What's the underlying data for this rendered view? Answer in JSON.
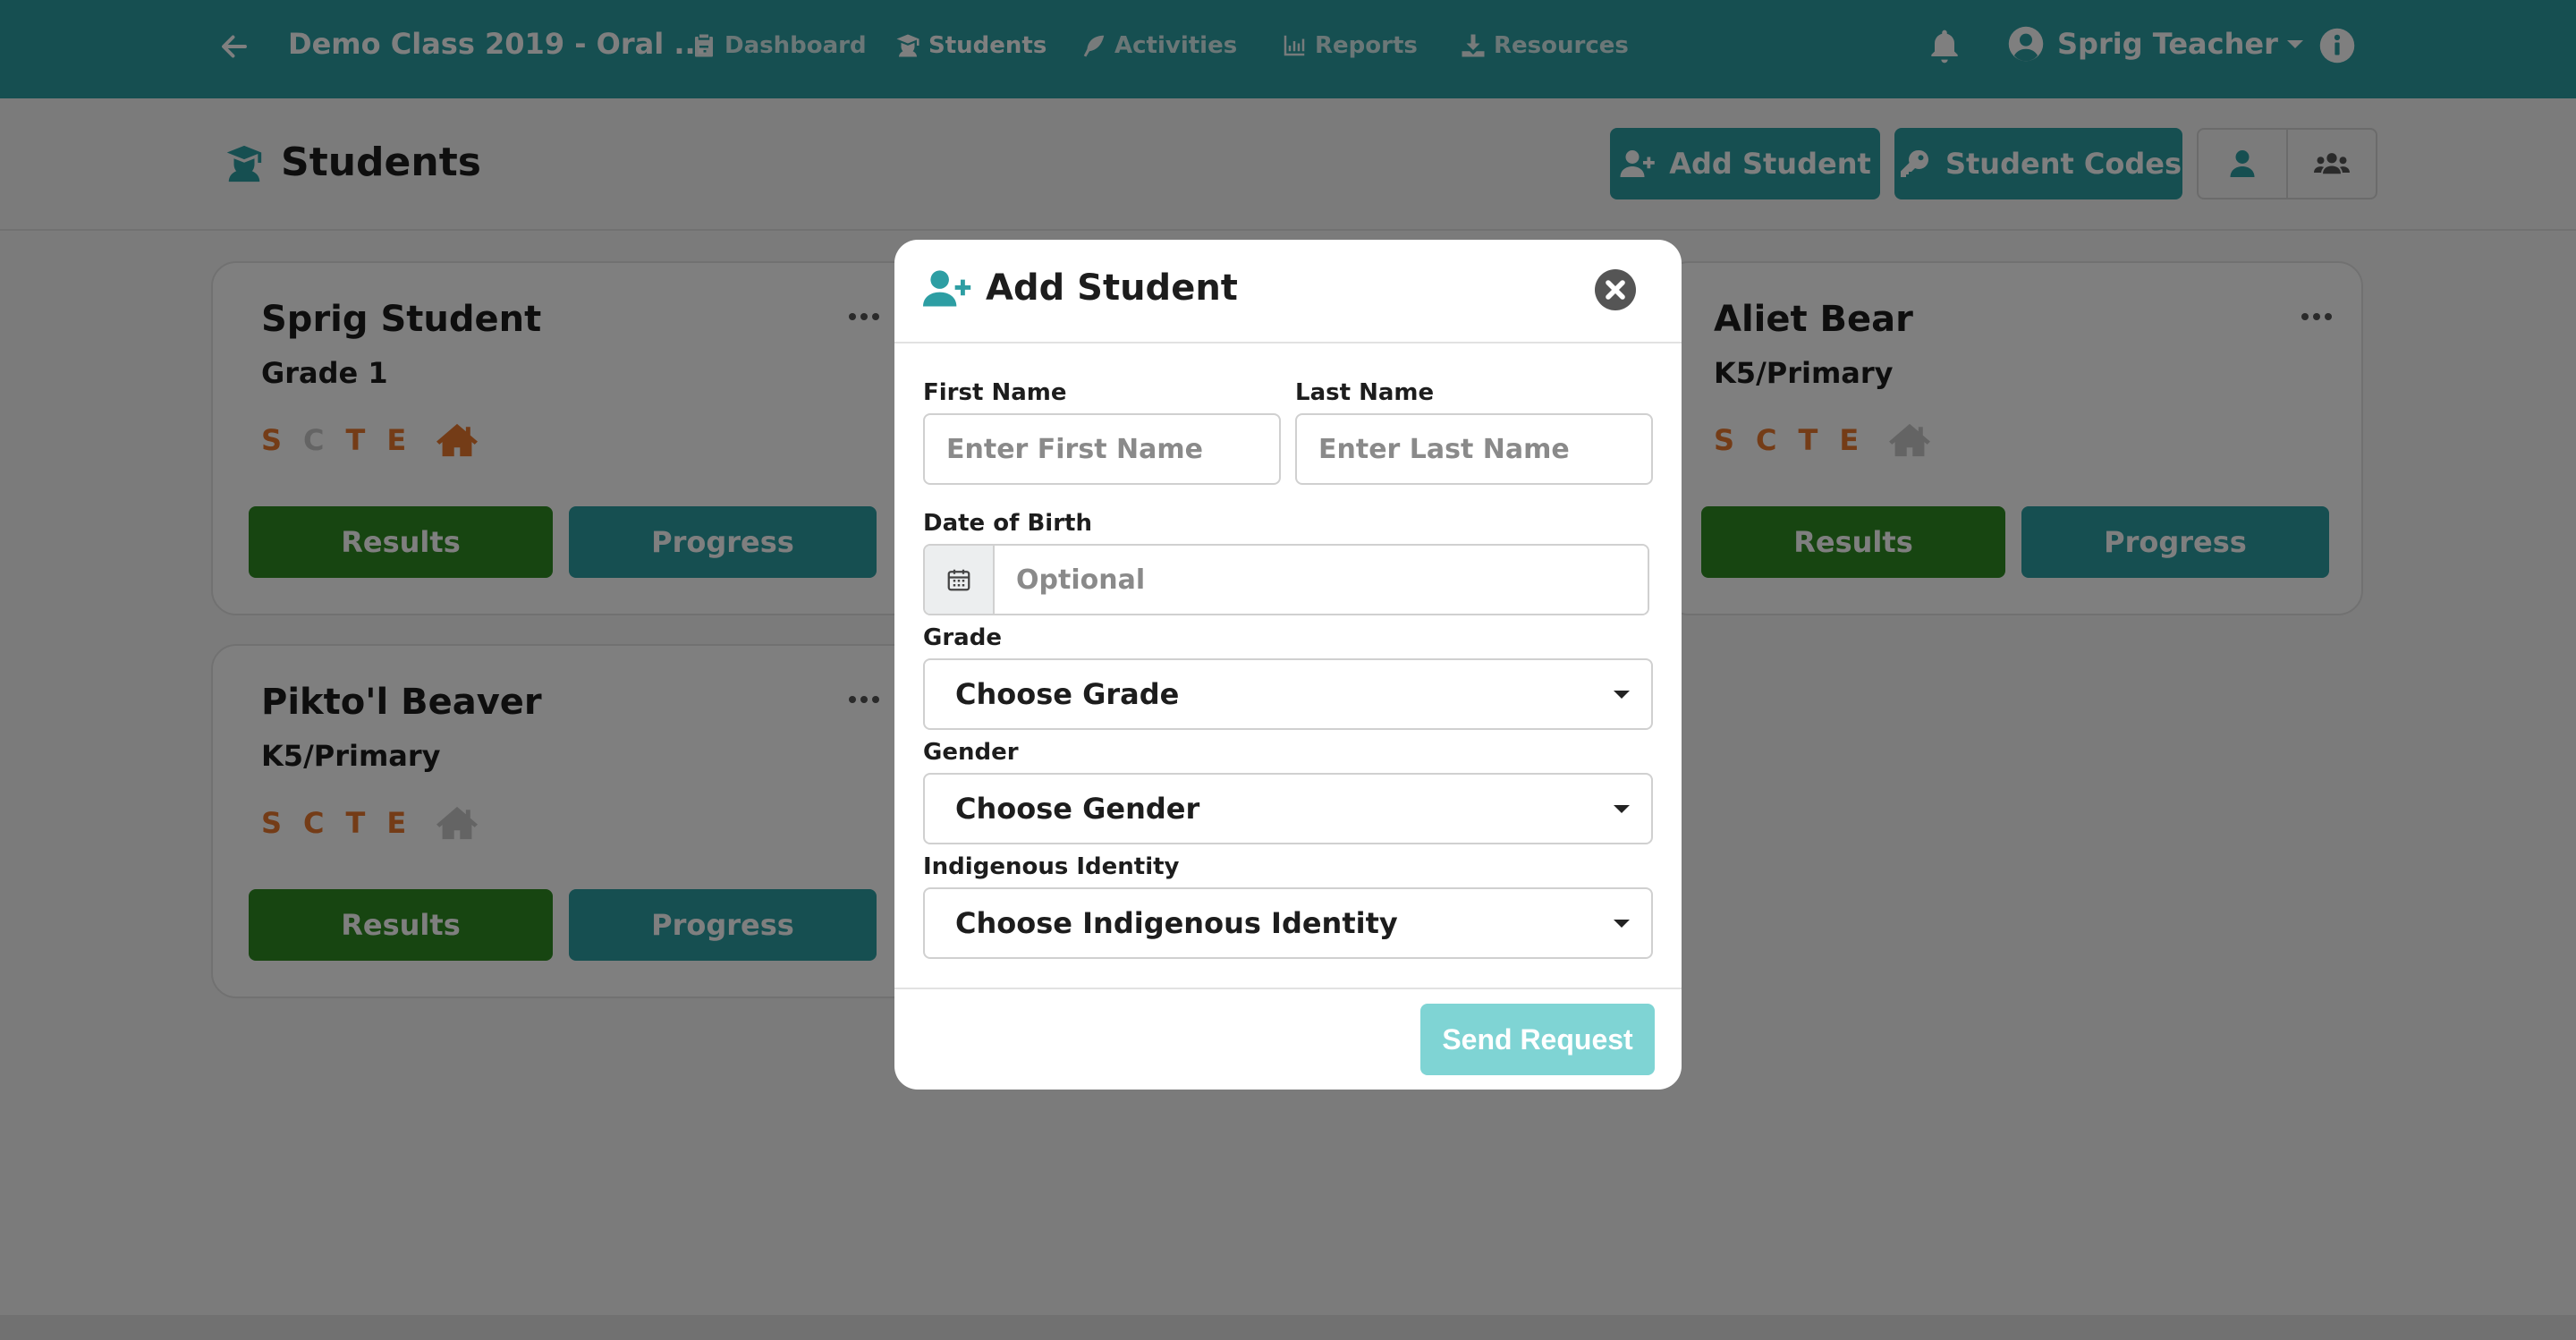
{
  "topbar": {
    "class_title": "Demo Class 2019 - Oral ...",
    "nav": [
      {
        "label": "Dashboard",
        "icon": "clipboard-icon"
      },
      {
        "label": "Students",
        "icon": "graduate-icon"
      },
      {
        "label": "Activities",
        "icon": "feather-icon"
      },
      {
        "label": "Reports",
        "icon": "bar-chart-icon"
      },
      {
        "label": "Resources",
        "icon": "download-icon"
      }
    ],
    "user_name": "Sprig Teacher"
  },
  "header": {
    "title": "Students",
    "add_student_label": "Add Student",
    "student_codes_label": "Student Codes"
  },
  "students": [
    {
      "name": "Sprig Student",
      "grade": "Grade 1",
      "letters": [
        "S",
        "C",
        "T",
        "E"
      ],
      "results": "Results",
      "progress": "Progress"
    },
    {
      "name": "Aliet Bear",
      "grade": "K5/Primary",
      "letters": [
        "S",
        "C",
        "T",
        "E"
      ],
      "results": "Results",
      "progress": "Progress"
    },
    {
      "name": "Pikto'l Beaver",
      "grade": "K5/Primary",
      "letters": [
        "S",
        "C",
        "T",
        "E"
      ],
      "results": "Results",
      "progress": "Progress"
    }
  ],
  "modal": {
    "title": "Add Student",
    "first_name_label": "First Name",
    "first_name_placeholder": "Enter First Name",
    "last_name_label": "Last Name",
    "last_name_placeholder": "Enter Last Name",
    "dob_label": "Date of Birth",
    "dob_placeholder": "Optional",
    "grade_label": "Grade",
    "grade_value": "Choose Grade",
    "gender_label": "Gender",
    "gender_value": "Choose Gender",
    "indigenous_label": "Indigenous Identity",
    "indigenous_value": "Choose Indigenous Identity",
    "send_label": "Send Request"
  },
  "colors": {
    "teal": "#2d9ea3",
    "green": "#2e8b22",
    "orange": "#e8782e",
    "send_disabled": "#7fd4d4"
  }
}
